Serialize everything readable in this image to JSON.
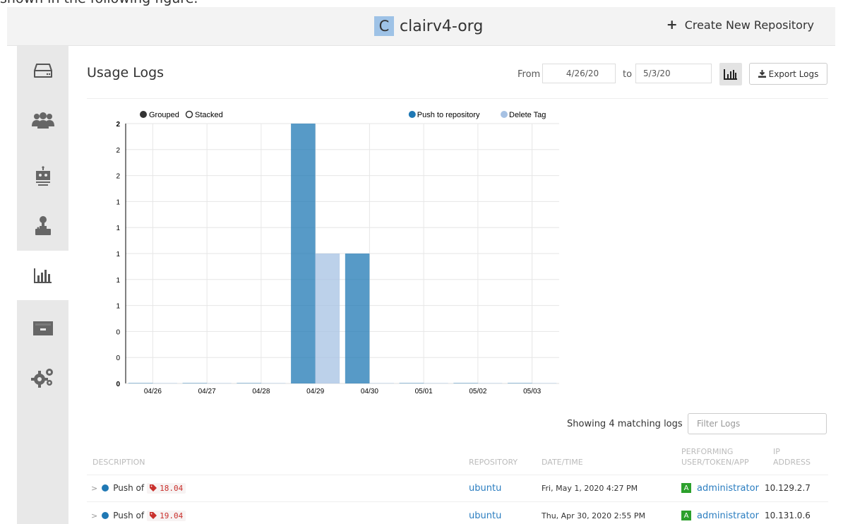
{
  "caption": "shown in the following figure.",
  "header": {
    "org_initial": "C",
    "org_name": "clairv4-org",
    "create_repo_label": "Create New Repository"
  },
  "sidebar": {
    "items": [
      {
        "icon": "hard-drive-icon"
      },
      {
        "icon": "users-icon"
      },
      {
        "icon": "robot-icon"
      },
      {
        "icon": "joystick-icon"
      },
      {
        "icon": "bar-chart-icon",
        "active": true
      },
      {
        "icon": "archive-icon"
      },
      {
        "icon": "gears-icon"
      }
    ]
  },
  "page": {
    "title": "Usage Logs",
    "from_label": "From",
    "from_date": "4/26/20",
    "to_label": "to",
    "to_date": "5/3/20",
    "export_label": "Export Logs",
    "showing_text": "Showing 4 matching logs",
    "filter_placeholder": "Filter Logs"
  },
  "chart_controls": {
    "grouped": "Grouped",
    "stacked": "Stacked",
    "selected_mode": "Grouped"
  },
  "chart_data": {
    "type": "bar",
    "categories": [
      "04/26",
      "04/27",
      "04/28",
      "04/29",
      "04/30",
      "05/01",
      "05/02",
      "05/03"
    ],
    "series": [
      {
        "name": "Push to repository",
        "color": "#1f78b4",
        "values": [
          0,
          0,
          0,
          2,
          1,
          0,
          0,
          0
        ]
      },
      {
        "name": "Delete Tag",
        "color": "#a6c1e3",
        "values": [
          0,
          0,
          0,
          1,
          0,
          0,
          0,
          0
        ]
      }
    ],
    "ylim": [
      0,
      2
    ],
    "ytick_labels": [
      "0",
      "0",
      "0",
      "1",
      "1",
      "1",
      "1",
      "1",
      "2",
      "2",
      "2"
    ],
    "legend_position": "top-right",
    "grid": true
  },
  "table": {
    "headers": {
      "description": "Description",
      "repository": "Repository",
      "datetime": "Date/Time",
      "performer": "Performing User/Token/App",
      "ip": "IP Address"
    },
    "rows": [
      {
        "action": "Push of",
        "tag": "18.04",
        "repository": "ubuntu",
        "datetime": "Fri, May 1, 2020 4:27 PM",
        "performer_badge": "A",
        "performer": "administrator",
        "ip": "10.129.2.7"
      },
      {
        "action": "Push of",
        "tag": "19.04",
        "repository": "ubuntu",
        "datetime": "Thu, Apr 30, 2020 2:55 PM",
        "performer_badge": "A",
        "performer": "administrator",
        "ip": "10.131.0.6"
      }
    ]
  }
}
